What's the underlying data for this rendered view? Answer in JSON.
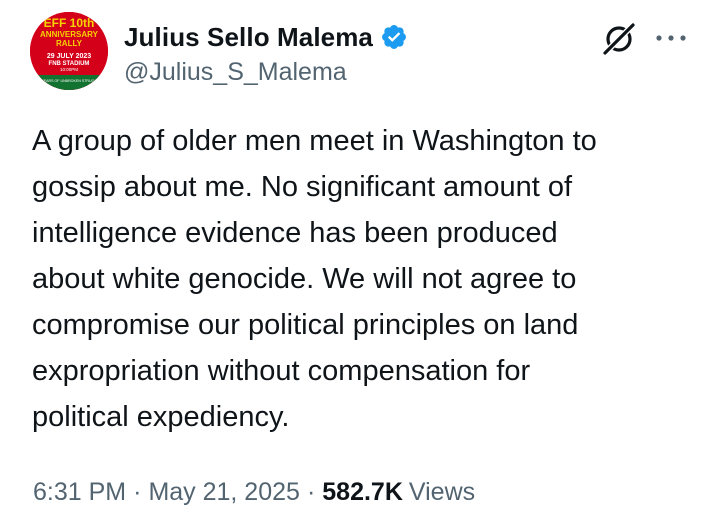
{
  "author": {
    "display_name": "Julius Sello Malema",
    "handle": "@Julius_S_Malema",
    "verified": true,
    "avatar": {
      "line1": "EFF 10th",
      "line2": "ANNIVERSARY",
      "line3": "RALLY",
      "line4": "29 JULY 2023",
      "line5": "FNB STADIUM",
      "line6": "10:00PM",
      "line7": "10 YEARS OF UNBROKEN STRUGGLE",
      "background": "#d4001a",
      "accent": "#f5d300"
    }
  },
  "icons": {
    "verified": "verified-badge-icon",
    "grok": "grok-icon",
    "more": "more-options-icon"
  },
  "colors": {
    "verified_blue": "#1d9bf0",
    "text_primary": "#0f1419",
    "text_secondary": "#536471"
  },
  "tweet": {
    "text": "A group of older men meet in Washington to\ngossip about me. No significant amount of\nintelligence evidence has been produced\nabout white genocide. We will not agree to\ncompromise our political principles on land\nexpropriation without compensation for\npolitical expediency."
  },
  "meta": {
    "time": "6:31 PM",
    "separator": "·",
    "date": "May 21, 2025",
    "views_count": "582.7K",
    "views_label": "Views"
  }
}
